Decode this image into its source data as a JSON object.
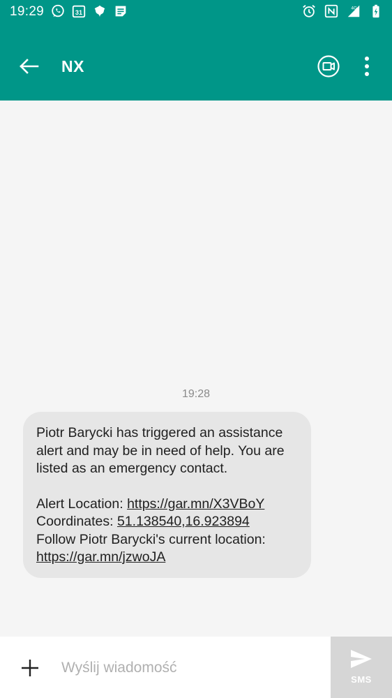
{
  "status_bar": {
    "time": "19:29",
    "calendar_day": "31",
    "network": "4G",
    "left_icons": [
      "whatsapp-icon",
      "calendar-icon",
      "gear-leaf-icon",
      "notes-icon"
    ],
    "right_icons": [
      "alarm-icon",
      "nfc-icon",
      "signal-icon",
      "battery-charging-icon"
    ]
  },
  "app_bar": {
    "title": "NX",
    "accent_color": "#009688"
  },
  "conversation": {
    "timestamp": "19:28",
    "message": {
      "paragraph1": "Piotr Barycki has triggered an assistance alert and may be in need of help. You are listed as an emergency contact.",
      "alert_location_label": "Alert Location: ",
      "alert_location_link": "https://gar.mn/X3VBoY",
      "coordinates_label": "Coordinates: ",
      "coordinates_value": "51.138540,16.923894",
      "follow_label": "Follow Piotr Barycki's current location:",
      "follow_link": "https://gar.mn/jzwoJA"
    }
  },
  "compose": {
    "placeholder": "Wyślij wiadomość",
    "send_label": "SMS"
  }
}
